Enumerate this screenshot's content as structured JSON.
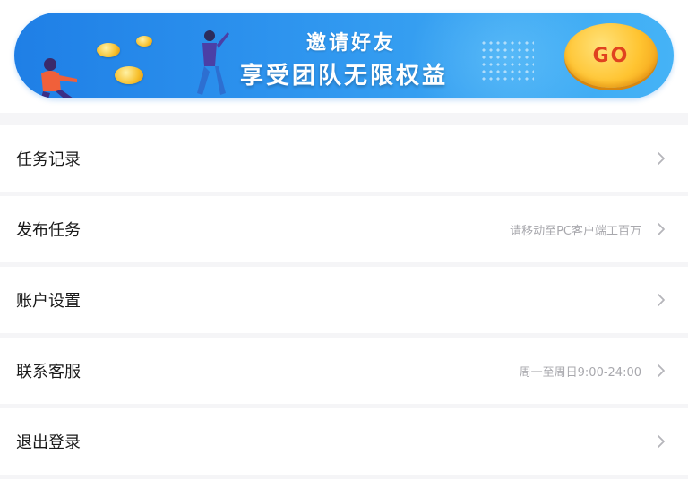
{
  "banner": {
    "title": "邀请好友",
    "subtitle": "享受团队无限权益",
    "go_label": "GO"
  },
  "menu": {
    "items": [
      {
        "label": "任务记录",
        "hint": ""
      },
      {
        "label": "发布任务",
        "hint": "请移动至PC客户端工百万"
      },
      {
        "label": "账户设置",
        "hint": ""
      },
      {
        "label": "联系客服",
        "hint": "周一至周日9:00-24:00"
      },
      {
        "label": "退出登录",
        "hint": ""
      }
    ]
  },
  "colors": {
    "banner_gradient_start": "#1f7fe6",
    "banner_gradient_end": "#45b3f6",
    "go_button": "#ffc431",
    "go_text": "#e0421f",
    "page_background": "#f5f5f7",
    "hint_text": "#a8a8ad"
  },
  "icons": [
    "chevron-right-icon",
    "coin-icon",
    "person-illustration"
  ]
}
